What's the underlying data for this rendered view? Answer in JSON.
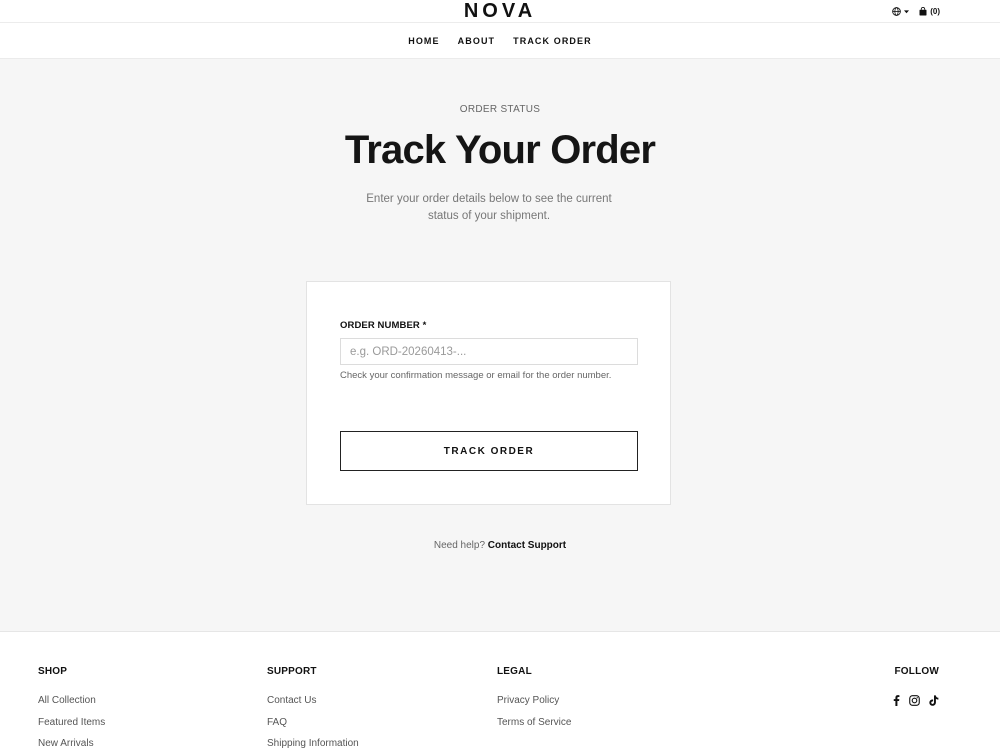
{
  "brand": {
    "logo": "NOVA"
  },
  "header": {
    "cart_label": "(0)",
    "nav": [
      {
        "label": "HOME"
      },
      {
        "label": "ABOUT"
      },
      {
        "label": "TRACK ORDER"
      }
    ]
  },
  "hero": {
    "eyebrow": "ORDER STATUS",
    "title": "Track Your Order",
    "subtitle": "Enter your order details below to see the current status of your shipment."
  },
  "form": {
    "order_label": "ORDER NUMBER *",
    "order_placeholder": "e.g. ORD-20260413-...",
    "order_value": "",
    "helper": "Check your confirmation message or email for the order number.",
    "submit_label": "TRACK ORDER"
  },
  "help": {
    "prefix": "Need help?",
    "link": "Contact Support"
  },
  "footer": {
    "shop": {
      "heading": "SHOP",
      "links": [
        "All Collection",
        "Featured Items",
        "New Arrivals"
      ]
    },
    "support": {
      "heading": "SUPPORT",
      "links": [
        "Contact Us",
        "FAQ",
        "Shipping Information"
      ]
    },
    "legal": {
      "heading": "LEGAL",
      "links": [
        "Privacy Policy",
        "Terms of Service"
      ]
    },
    "follow": {
      "heading": "FOLLOW",
      "icons": [
        "facebook-icon",
        "instagram-icon",
        "tiktok-icon"
      ]
    }
  }
}
